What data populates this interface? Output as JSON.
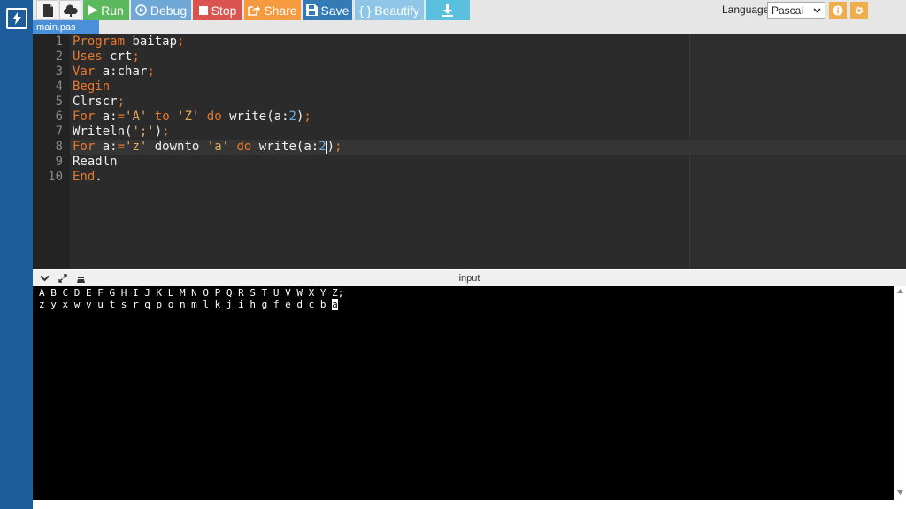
{
  "toolbar": {
    "run_label": "Run",
    "debug_label": "Debug",
    "stop_label": "Stop",
    "share_label": "Share",
    "save_label": "Save",
    "beautify_label": "{ } Beautify",
    "language_label": "Language",
    "language_value": "Pascal"
  },
  "file_tab": "main.pas",
  "editor": {
    "line_numbers": [
      "1",
      "2",
      "3",
      "4",
      "5",
      "6",
      "7",
      "8",
      "9",
      "10"
    ],
    "active_line": 8
  },
  "output": {
    "title": "input",
    "lines": [
      "A B C D E F G H I J K L M N O P Q R S T U V W X Y Z;",
      "z y x w v u t s r q p o n m l k j i h g f e d c b "
    ],
    "cursor_char": "a"
  },
  "colors": {
    "rail": "#1d5d9b",
    "run": "#5cb85c",
    "stop": "#d9534f",
    "save": "#337ab7",
    "share": "#f59a3e",
    "keyword": "#e8792e",
    "string": "#e8a85a",
    "number": "#6cb0e8"
  }
}
